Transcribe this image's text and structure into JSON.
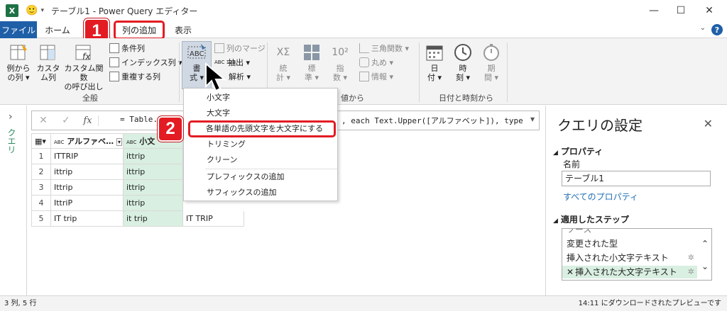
{
  "window": {
    "title": "テーブル1 - Power Query エディター",
    "app_icon": "X",
    "controls": {
      "minimize": "—",
      "maximize": "☐",
      "close": "✕"
    }
  },
  "tabs": {
    "file": "ファイル",
    "home": "ホーム",
    "add_column": "列の追加",
    "view": "表示",
    "help": "?"
  },
  "ribbon": {
    "general": {
      "label": "全般",
      "column_from_examples": [
        "例から",
        "の列 ▾"
      ],
      "custom_column": [
        "カスタ",
        "ム列"
      ],
      "invoke_custom_function": [
        "カスタム関数",
        "の呼び出し"
      ],
      "conditional_column": "条件列",
      "index_column": "インデックス列 ▾",
      "duplicate_column": "重複する列"
    },
    "text": {
      "format": [
        "書",
        "式 ▾"
      ],
      "format_icon_text": "ABC",
      "merge_columns": "列のマージ",
      "extract": "抽出 ▾",
      "parse": "解析 ▾",
      "extract_icon_text": "ABC 123"
    },
    "number": {
      "statistics": [
        "統",
        "計 ▾"
      ],
      "standard": [
        "標",
        "準 ▾"
      ],
      "scientific": [
        "指",
        "数 ▾"
      ],
      "trigonometry": "三角関数 ▾",
      "rounding": "丸め ▾",
      "information": "情報 ▾",
      "label_partial": "値から",
      "stat_icon_text": "XΣ",
      "sci_icon_text": "10²"
    },
    "datetime": {
      "label": "日付と時刻から",
      "date": [
        "日",
        "付 ▾"
      ],
      "time": [
        "時",
        "刻 ▾"
      ],
      "duration": [
        "期",
        "間 ▾"
      ]
    }
  },
  "badges": {
    "one": "1",
    "two": "2"
  },
  "format_menu": {
    "items": [
      "小文字",
      "大文字",
      "各単語の先頭文字を大文字にする",
      "トリミング",
      "クリーン",
      "プレフィックスの追加",
      "サフィックスの追加"
    ]
  },
  "left_panel": {
    "label": "クエリ",
    "chevron": "›"
  },
  "formula_bar": {
    "cancel": "✕",
    "commit": "✓",
    "fx": "fx",
    "text_start": "= Table.Ad",
    "text_end": ", each Text.Upper([アルファベット]), type",
    "caret": "▾"
  },
  "table": {
    "headers": [
      "アルファベ…",
      "小文"
    ],
    "header_type_icon": "ABC",
    "rows": [
      {
        "n": "1",
        "a": "ITTRIP",
        "b": "ittrip",
        "c": ""
      },
      {
        "n": "2",
        "a": "ittrip",
        "b": "ittrip",
        "c": ""
      },
      {
        "n": "3",
        "a": "Ittrip",
        "b": "ittrip",
        "c": ""
      },
      {
        "n": "4",
        "a": "IttriP",
        "b": "ittrip",
        "c": ""
      },
      {
        "n": "5",
        "a": "IT trip",
        "b": "it trip",
        "c": "IT TRIP"
      }
    ]
  },
  "query_settings": {
    "title": "クエリの設定",
    "close": "✕",
    "properties_header": "プロパティ",
    "name_label": "名前",
    "name_value": "テーブル1",
    "all_properties": "すべてのプロパティ",
    "applied_steps_header": "適用したステップ",
    "steps": [
      {
        "label": "ソース",
        "gear": "",
        "x": ""
      },
      {
        "label": "変更された型",
        "gear": "",
        "x": ""
      },
      {
        "label": "挿入された小文字テキスト",
        "gear": "✲",
        "x": ""
      },
      {
        "label": "挿入された大文字テキスト",
        "gear": "✲",
        "x": "✕"
      }
    ]
  },
  "status": {
    "left": "3 列, 5 行",
    "right": "14:11 にダウンロードされたプレビューです"
  },
  "colors": {
    "accent_red": "#e31b23",
    "file_tab_blue": "#1f5fa8",
    "selected_green": "#d9efe1",
    "query_green": "#2f8a5e",
    "excel_green": "#1e7145"
  }
}
